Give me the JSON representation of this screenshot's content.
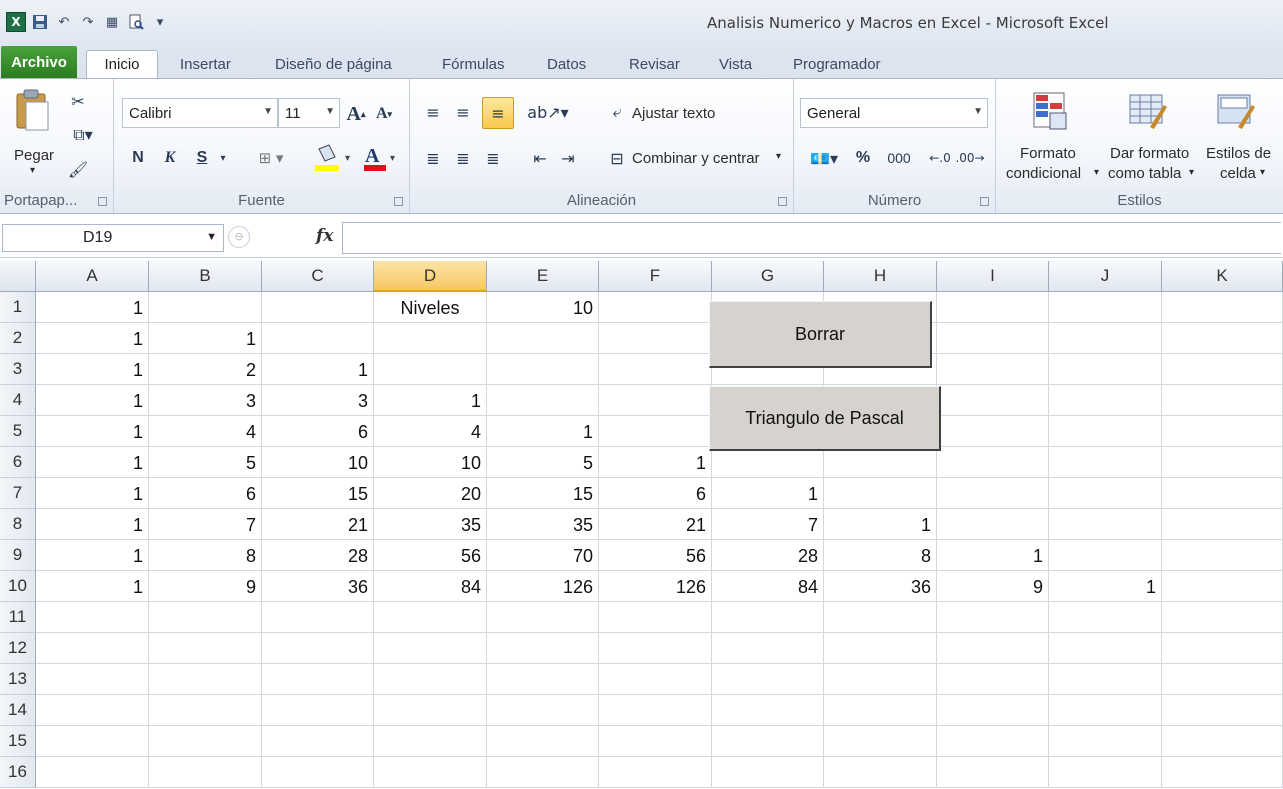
{
  "window": {
    "title": "Analisis Numerico y Macros en Excel  -  Microsoft Excel"
  },
  "quick_access": [
    {
      "name": "excel-logo-icon",
      "glyph": "X"
    },
    {
      "name": "save-icon",
      "glyph": "💾"
    },
    {
      "name": "undo-icon",
      "glyph": "↶"
    },
    {
      "name": "redo-icon",
      "glyph": "↷"
    },
    {
      "name": "grid-icon",
      "glyph": "▦"
    },
    {
      "name": "print-preview-icon",
      "glyph": "🔍"
    },
    {
      "name": "customize-qat-icon",
      "glyph": "▾"
    }
  ],
  "tabs": [
    "Archivo",
    "Inicio",
    "Insertar",
    "Diseño de página",
    "Fórmulas",
    "Datos",
    "Revisar",
    "Vista",
    "Programador"
  ],
  "ribbon": {
    "clipboard": {
      "paste": "Pegar",
      "label": "Portapap..."
    },
    "font": {
      "name": "Calibri",
      "size": "11",
      "bold": "N",
      "italic": "K",
      "underline": "S",
      "label": "Fuente"
    },
    "alignment": {
      "wrap": "Ajustar texto",
      "merge": "Combinar y centrar",
      "label": "Alineación"
    },
    "number": {
      "format": "General",
      "percent": "%",
      "thousands": "000",
      "label": "Número"
    },
    "styles": {
      "conditional": [
        "Formato",
        "condicional"
      ],
      "table": [
        "Dar formato",
        "como tabla"
      ],
      "cell": [
        "Estilos de",
        "celda"
      ],
      "label": "Estilos"
    }
  },
  "formula_bar": {
    "name_box": "D19",
    "fx": "fx",
    "content": ""
  },
  "columns": [
    "A",
    "B",
    "C",
    "D",
    "E",
    "F",
    "G",
    "H",
    "I",
    "J",
    "K"
  ],
  "selected_column": "D",
  "rows": [
    "1",
    "2",
    "3",
    "4",
    "5",
    "6",
    "7",
    "8",
    "9",
    "10",
    "11",
    "12",
    "13",
    "14",
    "15",
    "16"
  ],
  "cells": [
    [
      "1",
      "",
      "",
      "Niveles",
      "10",
      "",
      "",
      "",
      "",
      "",
      ""
    ],
    [
      "1",
      "1",
      "",
      "",
      "",
      "",
      "",
      "",
      "",
      "",
      ""
    ],
    [
      "1",
      "2",
      "1",
      "",
      "",
      "",
      "",
      "",
      "",
      "",
      ""
    ],
    [
      "1",
      "3",
      "3",
      "1",
      "",
      "",
      "",
      "",
      "",
      "",
      ""
    ],
    [
      "1",
      "4",
      "6",
      "4",
      "1",
      "",
      "",
      "",
      "",
      "",
      ""
    ],
    [
      "1",
      "5",
      "10",
      "10",
      "5",
      "1",
      "",
      "",
      "",
      "",
      ""
    ],
    [
      "1",
      "6",
      "15",
      "20",
      "15",
      "6",
      "1",
      "",
      "",
      "",
      ""
    ],
    [
      "1",
      "7",
      "21",
      "35",
      "35",
      "21",
      "7",
      "1",
      "",
      "",
      ""
    ],
    [
      "1",
      "8",
      "28",
      "56",
      "70",
      "56",
      "28",
      "8",
      "1",
      "",
      ""
    ],
    [
      "1",
      "9",
      "36",
      "84",
      "126",
      "126",
      "84",
      "36",
      "9",
      "1",
      ""
    ],
    [
      "",
      "",
      "",
      "",
      "",
      "",
      "",
      "",
      "",
      "",
      ""
    ],
    [
      "",
      "",
      "",
      "",
      "",
      "",
      "",
      "",
      "",
      "",
      ""
    ],
    [
      "",
      "",
      "",
      "",
      "",
      "",
      "",
      "",
      "",
      "",
      ""
    ],
    [
      "",
      "",
      "",
      "",
      "",
      "",
      "",
      "",
      "",
      "",
      ""
    ],
    [
      "",
      "",
      "",
      "",
      "",
      "",
      "",
      "",
      "",
      "",
      ""
    ],
    [
      "",
      "",
      "",
      "",
      "",
      "",
      "",
      "",
      "",
      "",
      ""
    ]
  ],
  "buttons": {
    "clear": "Borrar",
    "pascal": "Triangulo de Pascal"
  }
}
